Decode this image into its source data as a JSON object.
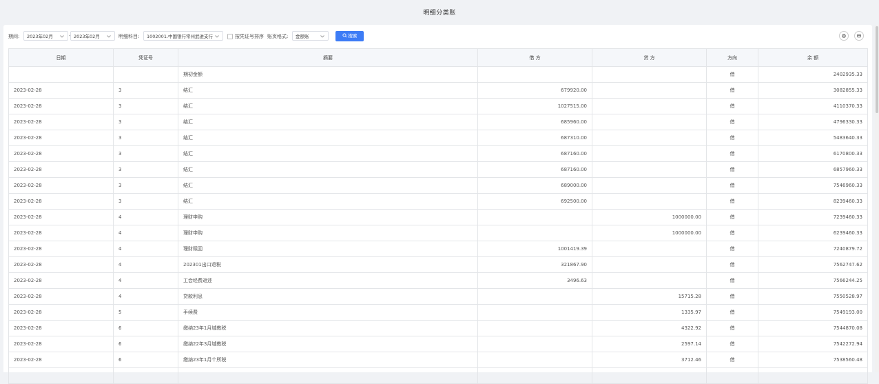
{
  "page": {
    "title": "明细分类账"
  },
  "toolbar": {
    "period_label": "期间:",
    "period_from": "2023年02月",
    "period_sep": "-",
    "period_to": "2023年02月",
    "account_label": "明细科目:",
    "account_value": "1002001.中国银行常州武进支行",
    "sort_label": "按凭证号排序",
    "format_label": "账页格式:",
    "format_value": "金额账",
    "search_label": "搜索"
  },
  "table": {
    "headers": [
      "日期",
      "凭证号",
      "摘要",
      "借 方",
      "贷 方",
      "方向",
      "余 额"
    ],
    "rows": [
      {
        "date": "",
        "voucher": "",
        "summary": "期初金额",
        "debit": "",
        "credit": "",
        "dir": "借",
        "balance": "2402935.33"
      },
      {
        "date": "2023-02-28",
        "voucher": "3",
        "summary": "结汇",
        "debit": "679920.00",
        "credit": "",
        "dir": "借",
        "balance": "3082855.33"
      },
      {
        "date": "2023-02-28",
        "voucher": "3",
        "summary": "结汇",
        "debit": "1027515.00",
        "credit": "",
        "dir": "借",
        "balance": "4110370.33"
      },
      {
        "date": "2023-02-28",
        "voucher": "3",
        "summary": "结汇",
        "debit": "685960.00",
        "credit": "",
        "dir": "借",
        "balance": "4796330.33"
      },
      {
        "date": "2023-02-28",
        "voucher": "3",
        "summary": "结汇",
        "debit": "687310.00",
        "credit": "",
        "dir": "借",
        "balance": "5483640.33"
      },
      {
        "date": "2023-02-28",
        "voucher": "3",
        "summary": "结汇",
        "debit": "687160.00",
        "credit": "",
        "dir": "借",
        "balance": "6170800.33"
      },
      {
        "date": "2023-02-28",
        "voucher": "3",
        "summary": "结汇",
        "debit": "687160.00",
        "credit": "",
        "dir": "借",
        "balance": "6857960.33"
      },
      {
        "date": "2023-02-28",
        "voucher": "3",
        "summary": "结汇",
        "debit": "689000.00",
        "credit": "",
        "dir": "借",
        "balance": "7546960.33"
      },
      {
        "date": "2023-02-28",
        "voucher": "3",
        "summary": "结汇",
        "debit": "692500.00",
        "credit": "",
        "dir": "借",
        "balance": "8239460.33"
      },
      {
        "date": "2023-02-28",
        "voucher": "4",
        "summary": "理财申购",
        "debit": "",
        "credit": "1000000.00",
        "dir": "借",
        "balance": "7239460.33"
      },
      {
        "date": "2023-02-28",
        "voucher": "4",
        "summary": "理财申购",
        "debit": "",
        "credit": "1000000.00",
        "dir": "借",
        "balance": "6239460.33"
      },
      {
        "date": "2023-02-28",
        "voucher": "4",
        "summary": "理财赎回",
        "debit": "1001419.39",
        "credit": "",
        "dir": "借",
        "balance": "7240879.72"
      },
      {
        "date": "2023-02-28",
        "voucher": "4",
        "summary": "202301出口退税",
        "debit": "321867.90",
        "credit": "",
        "dir": "借",
        "balance": "7562747.62"
      },
      {
        "date": "2023-02-28",
        "voucher": "4",
        "summary": "工会经费返还",
        "debit": "3496.63",
        "credit": "",
        "dir": "借",
        "balance": "7566244.25"
      },
      {
        "date": "2023-02-28",
        "voucher": "4",
        "summary": "贷款利息",
        "debit": "",
        "credit": "15715.28",
        "dir": "借",
        "balance": "7550528.97"
      },
      {
        "date": "2023-02-28",
        "voucher": "5",
        "summary": "手续费",
        "debit": "",
        "credit": "1335.97",
        "dir": "借",
        "balance": "7549193.00"
      },
      {
        "date": "2023-02-28",
        "voucher": "6",
        "summary": "缴纳23年1月城教税",
        "debit": "",
        "credit": "4322.92",
        "dir": "借",
        "balance": "7544870.08"
      },
      {
        "date": "2023-02-28",
        "voucher": "6",
        "summary": "缴纳22年3月城教税",
        "debit": "",
        "credit": "2597.14",
        "dir": "借",
        "balance": "7542272.94"
      },
      {
        "date": "2023-02-28",
        "voucher": "6",
        "summary": "缴纳23年1月个所税",
        "debit": "",
        "credit": "3712.46",
        "dir": "借",
        "balance": "7538560.48"
      },
      {
        "date": "",
        "voucher": "",
        "summary": "",
        "debit": "",
        "credit": "",
        "dir": "",
        "balance": ""
      }
    ]
  },
  "colors": {
    "accent": "#3d7cf6",
    "header_bg": "#f5f7fa",
    "page_bg": "#f0f2f5"
  },
  "icons": {
    "search": "search-icon",
    "print": "print-icon",
    "export": "export-icon",
    "chevron": "chevron-down-icon"
  }
}
